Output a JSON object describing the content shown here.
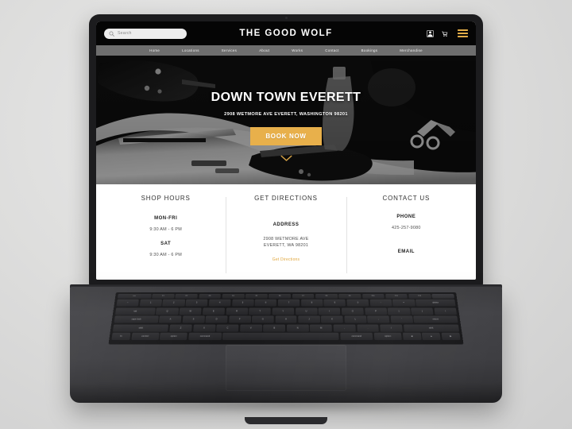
{
  "site": {
    "brand": "THE GOOD WOLF",
    "search": {
      "placeholder": "Search",
      "icon": "search-icon"
    },
    "header_icons": [
      {
        "name": "account-icon",
        "glyph": "account"
      },
      {
        "name": "cart-icon",
        "glyph": "cart"
      },
      {
        "name": "hamburger-menu-icon",
        "glyph": "hamburger"
      }
    ],
    "nav": [
      {
        "label": "Home"
      },
      {
        "label": "Locations"
      },
      {
        "label": "Services"
      },
      {
        "label": "About"
      },
      {
        "label": "Works"
      },
      {
        "label": "Contact"
      },
      {
        "label": "Bookings"
      },
      {
        "label": "Merchandise"
      }
    ],
    "hero": {
      "title": "DOWN TOWN EVERETT",
      "subtitle": "2908 WETMORE AVE EVERETT, WASHINGTON 98201",
      "cta_label": "BOOK NOW",
      "scroll_icon": "chevron-down-icon"
    },
    "info_columns": [
      {
        "title": "SHOP HOURS",
        "rows": [
          {
            "label": "MON-FRI",
            "value": "9:30 AM - 6 PM"
          },
          {
            "label": "SAT",
            "value": "9:30 AM - 6 PM"
          }
        ]
      },
      {
        "title": "GET DIRECTIONS",
        "label": "ADDRESS",
        "address_line1": "2908 WETMORE AVE",
        "address_line2": "EVERETT, WA 98201",
        "link_label": "Get Directions"
      },
      {
        "title": "CONTACT US",
        "phone_label": "PHONE",
        "phone_value": "425-257-9080",
        "email_label": "EMAIL"
      }
    ],
    "colors": {
      "accent_amber": "#e8b04b",
      "link_amber": "#e0a63c",
      "header_black": "#050505",
      "nav_gray": "#6e6e6e"
    }
  },
  "device": {
    "keyboard": {
      "fn_row": [
        "esc",
        "F1",
        "F2",
        "F3",
        "F4",
        "F5",
        "F6",
        "F7",
        "F8",
        "F9",
        "F10",
        "F11",
        "F12",
        ""
      ],
      "row1": [
        "~",
        "1",
        "2",
        "3",
        "4",
        "5",
        "6",
        "7",
        "8",
        "9",
        "0",
        "-",
        "=",
        "delete"
      ],
      "row2": [
        "tab",
        "Q",
        "W",
        "E",
        "R",
        "T",
        "Y",
        "U",
        "I",
        "O",
        "P",
        "[",
        "]",
        "\\"
      ],
      "row3": [
        "caps lock",
        "A",
        "S",
        "D",
        "F",
        "G",
        "H",
        "J",
        "K",
        "L",
        ";",
        "'",
        "return"
      ],
      "row4": [
        "shift",
        "Z",
        "X",
        "C",
        "V",
        "B",
        "N",
        "M",
        ",",
        ".",
        "/",
        "shift"
      ],
      "row5": [
        "fn",
        "control",
        "option",
        "command",
        "",
        "command",
        "option"
      ]
    }
  }
}
